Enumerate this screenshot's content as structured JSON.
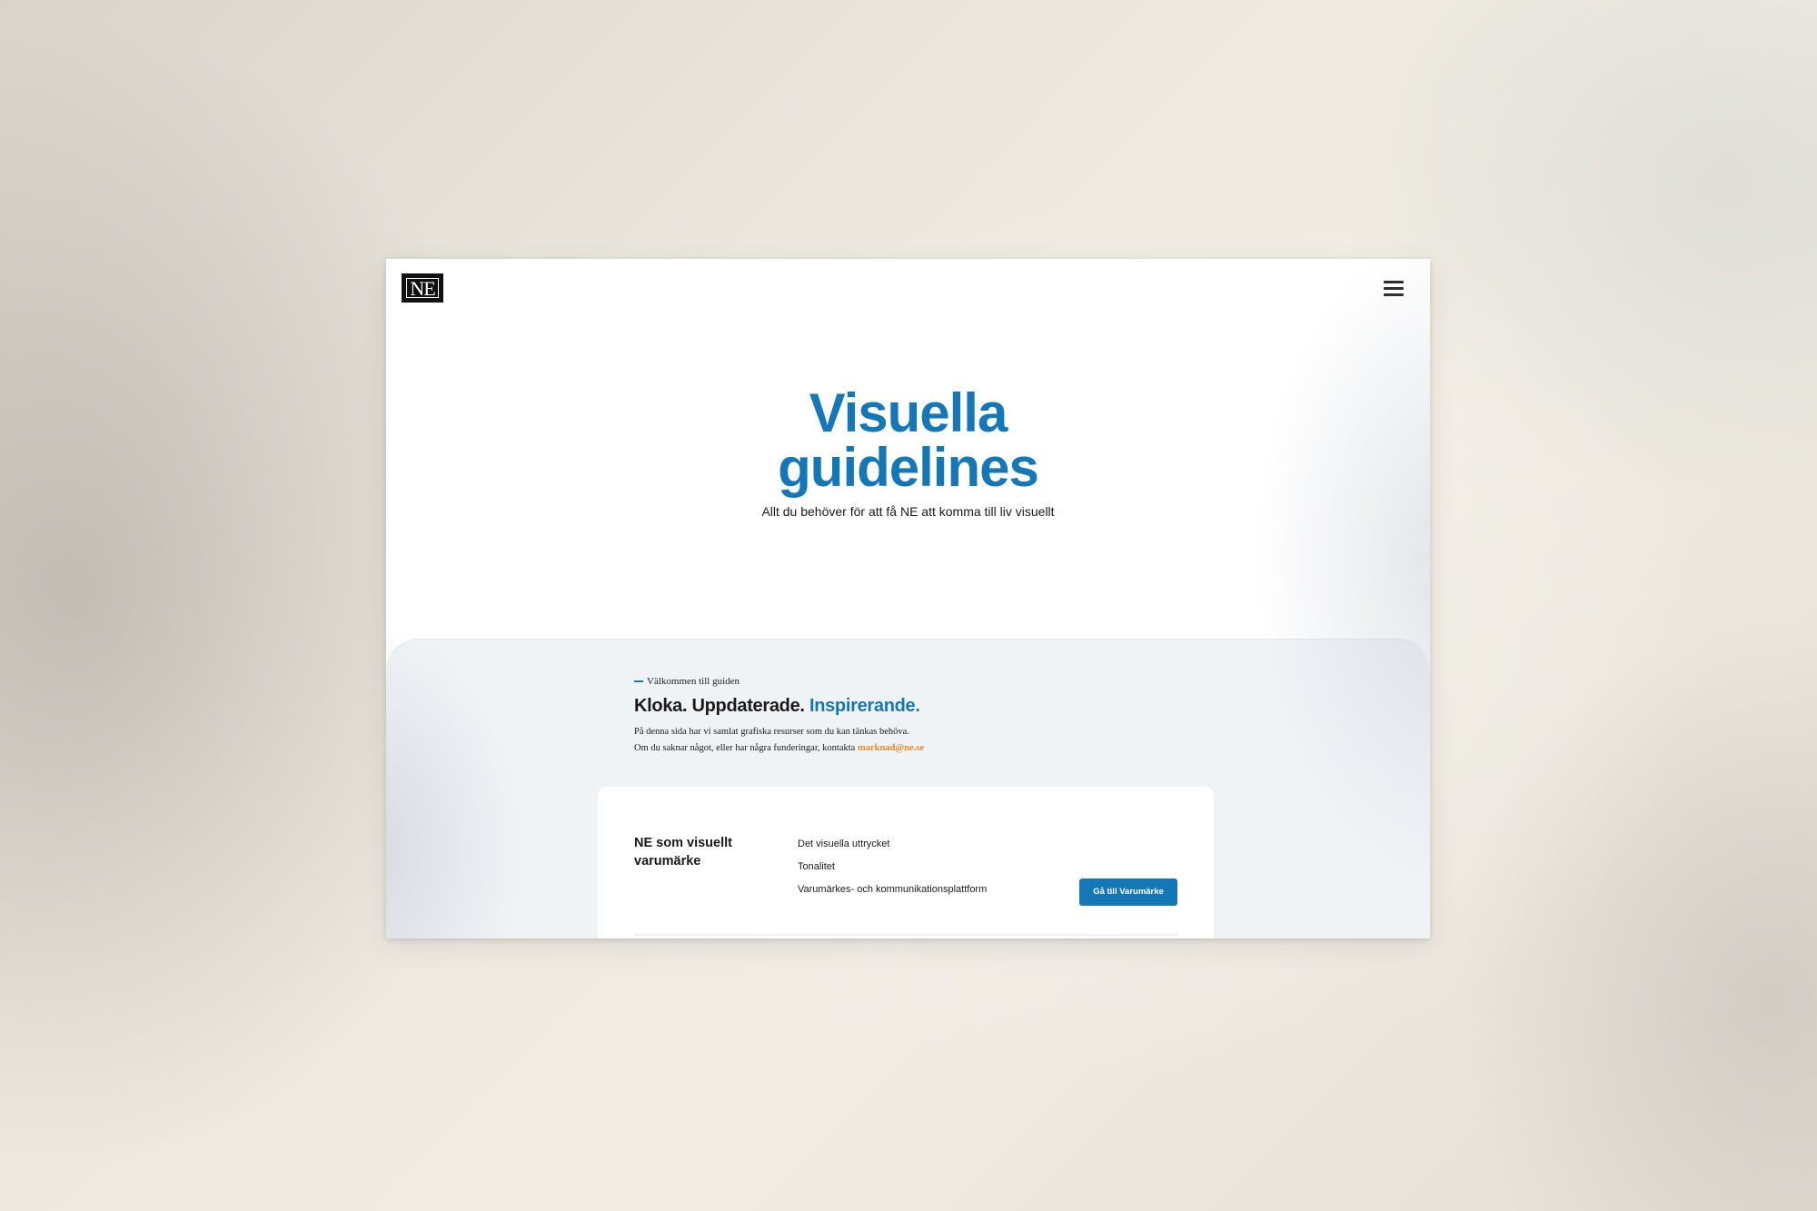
{
  "header": {
    "logo_text": "NE",
    "menu_icon": "hamburger-icon"
  },
  "hero": {
    "title": "Visuella guidelines",
    "subtitle": "Allt du behöver för att få NE att komma till liv visuellt"
  },
  "intro": {
    "eyebrow": "Välkommen till guiden",
    "heading_part1": "Kloka. Uppdaterade. ",
    "heading_accent": "Inspirerande.",
    "line1": "På denna sida har vi samlat grafiska resurser som du kan tänkas behöva.",
    "line2_prefix": "Om du saknar något, eller har några funderingar, kontakta ",
    "email": "marknad@ne.se"
  },
  "card": {
    "title": "NE som visuellt varumärke",
    "links": [
      "Det visuella uttrycket",
      "Tonalitet",
      "Varumärkes- och kommunikationsplattform"
    ],
    "button_label": "Gå till Varumärke"
  },
  "colors": {
    "brand_blue": "#1677b7",
    "email_orange": "#e8892c",
    "section_bg": "#f0f3f6"
  }
}
